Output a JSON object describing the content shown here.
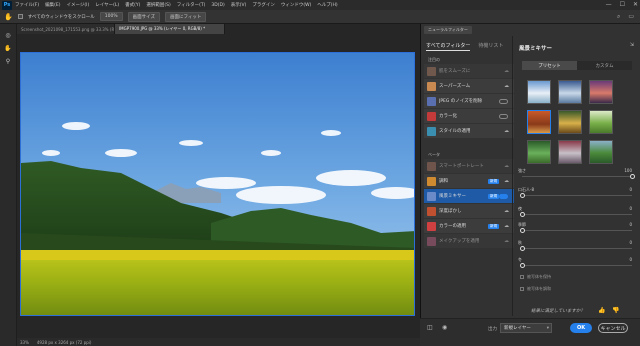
{
  "menu": {
    "app": "Ps",
    "items": [
      "ファイル(F)",
      "編集(E)",
      "イメージ(I)",
      "レイヤー(L)",
      "書式(Y)",
      "選択範囲(S)",
      "フィルター(T)",
      "3D(D)",
      "表示(V)",
      "プラグイン",
      "ウィンドウ(W)",
      "ヘルプ(H)"
    ],
    "win_min": "—",
    "win_max": "☐",
    "win_close": "✕"
  },
  "options": {
    "scroll_all_label": "すべてのウィンドウをスクロール",
    "zoom_label": "100%",
    "fit_button": "画面サイズ",
    "fill_button": "画面にフィット"
  },
  "tabs": [
    {
      "label": "Screenshot_2021098_171553.png @ 33.3% (RGB/8#) *"
    },
    {
      "label": "IMGP7900.JPG @ 33% (レイヤー 0, RGB/8) *"
    }
  ],
  "status": {
    "zoom": "33%",
    "size": "4928 px x 3264 px (72 ppi)"
  },
  "neural": {
    "panel_title": "ニューラルフィルター",
    "tabs": [
      "すべてのフィルター",
      "待機リスト"
    ],
    "featured_label": "注目の",
    "beta_label": "ベータ",
    "featured": [
      {
        "name": "肌をスムーズに",
        "dim": true
      },
      {
        "name": "スーパーズーム",
        "dim": false
      },
      {
        "name": "JPEG のノイズを削除",
        "dim": false
      },
      {
        "name": "カラー化",
        "dim": false
      },
      {
        "name": "スタイルの適用",
        "dim": false
      }
    ],
    "beta": [
      {
        "name": "スマートポートレート",
        "dim": true
      },
      {
        "name": "調和",
        "dim": false,
        "badge": "新規"
      },
      {
        "name": "風景ミキサー",
        "dim": false,
        "badge": "新規",
        "selected": true
      },
      {
        "name": "深度ぼかし",
        "dim": false
      },
      {
        "name": "カラーの適用",
        "dim": false,
        "badge": "新規"
      },
      {
        "name": "メイクアップを適用",
        "dim": true
      }
    ],
    "settings_title": "風景ミキサー",
    "preset_tab": "プリセット",
    "custom_tab": "カスタム",
    "sliders": [
      {
        "label": "強さ",
        "value": "100",
        "fraction": 1.0
      },
      {
        "label": "ロ石人-8",
        "value": "0",
        "fraction": 0.0
      },
      {
        "label": "夜",
        "value": "0",
        "fraction": 0.0
      },
      {
        "label": "季節",
        "value": "0",
        "fraction": 0.0
      },
      {
        "label": "秋",
        "value": "0",
        "fraction": 0.0
      },
      {
        "label": "冬",
        "value": "0",
        "fraction": 0.0
      }
    ],
    "checkbox1": "被写体を保持",
    "checkbox2": "被写体を調和",
    "question": "結果に満足していますか？",
    "output_label": "出力",
    "output_value": "新規レイヤー",
    "ok": "OK",
    "cancel": "キャンセル"
  },
  "icon_names": [
    "eye-icon",
    "hand-icon",
    "zoom-icon",
    "layers-icon",
    "preview-icon"
  ],
  "colors": {
    "accent": "#2680eb",
    "panel": "#323232",
    "selection": "#1f5aa6"
  }
}
